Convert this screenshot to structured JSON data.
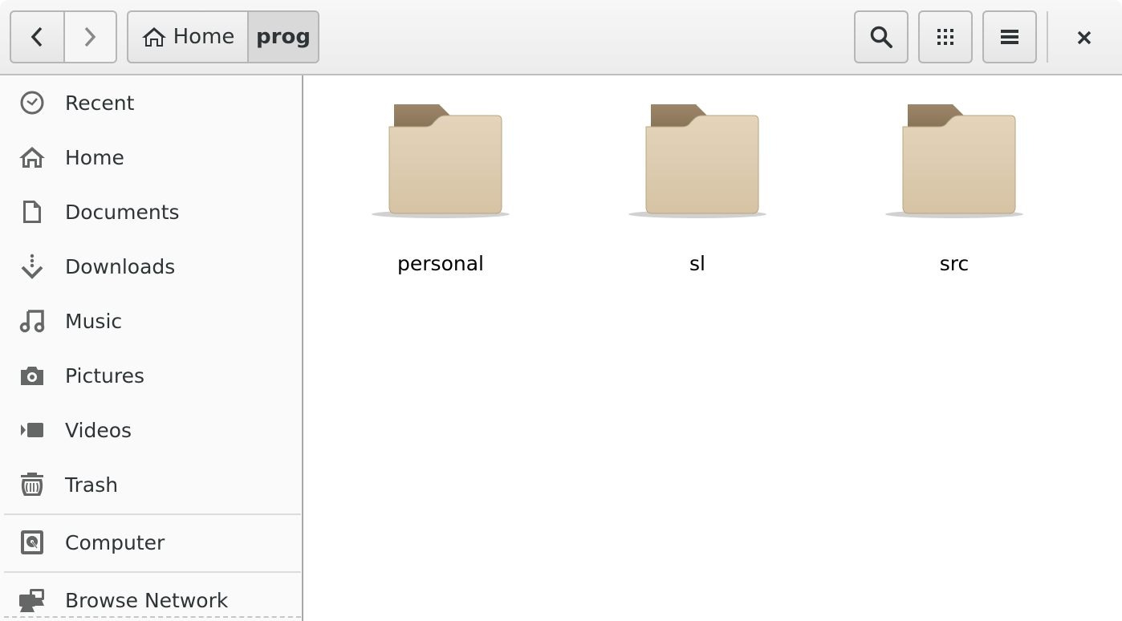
{
  "headerbar": {
    "back_icon": "chevron-left-icon",
    "forward_icon": "chevron-right-icon",
    "breadcrumb": [
      {
        "label": "Home",
        "icon": "home-icon"
      },
      {
        "label": "prog",
        "active": true
      }
    ],
    "search_icon": "search-icon",
    "view_icon": "grid-view-icon",
    "menu_icon": "hamburger-menu-icon",
    "close_icon": "close-icon"
  },
  "sidebar": {
    "items": [
      {
        "label": "Recent",
        "icon": "clock-icon"
      },
      {
        "label": "Home",
        "icon": "home-icon"
      },
      {
        "label": "Documents",
        "icon": "document-icon"
      },
      {
        "label": "Downloads",
        "icon": "download-icon"
      },
      {
        "label": "Music",
        "icon": "music-icon"
      },
      {
        "label": "Pictures",
        "icon": "camera-icon"
      },
      {
        "label": "Videos",
        "icon": "video-icon"
      },
      {
        "label": "Trash",
        "icon": "trash-icon"
      },
      {
        "label": "Computer",
        "icon": "harddisk-icon"
      },
      {
        "label": "Browse Network",
        "icon": "network-icon"
      }
    ]
  },
  "content": {
    "files": [
      {
        "name": "personal",
        "type": "folder"
      },
      {
        "name": "sl",
        "type": "folder"
      },
      {
        "name": "src",
        "type": "folder"
      }
    ]
  },
  "colors": {
    "folder_front": "#dccbb0",
    "folder_back": "#8f7a5e",
    "icon_gray": "#656767"
  }
}
